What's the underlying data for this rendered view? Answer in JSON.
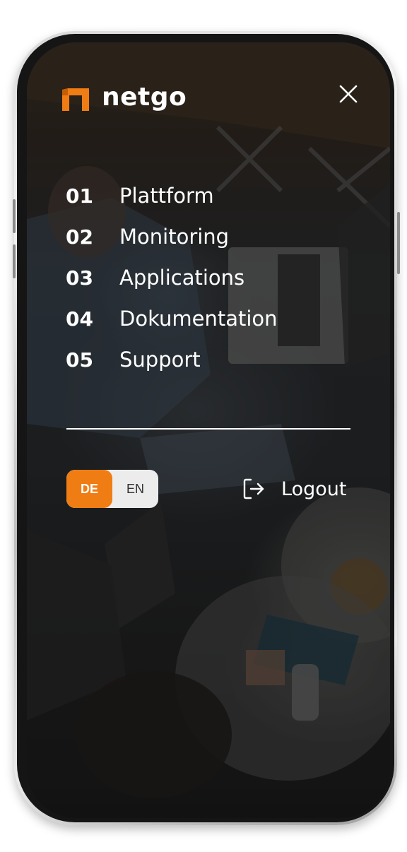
{
  "brand": {
    "name": "netgo",
    "accent": "#f07d14"
  },
  "header": {
    "close_icon": "close-icon"
  },
  "menu": {
    "items": [
      {
        "number": "01",
        "label": "Plattform"
      },
      {
        "number": "02",
        "label": "Monitoring"
      },
      {
        "number": "03",
        "label": "Applications"
      },
      {
        "number": "04",
        "label": "Dokumentation"
      },
      {
        "number": "05",
        "label": "Support"
      }
    ]
  },
  "language": {
    "options": [
      "DE",
      "EN"
    ],
    "selected": "DE"
  },
  "logout": {
    "label": "Logout",
    "icon": "logout-icon"
  }
}
